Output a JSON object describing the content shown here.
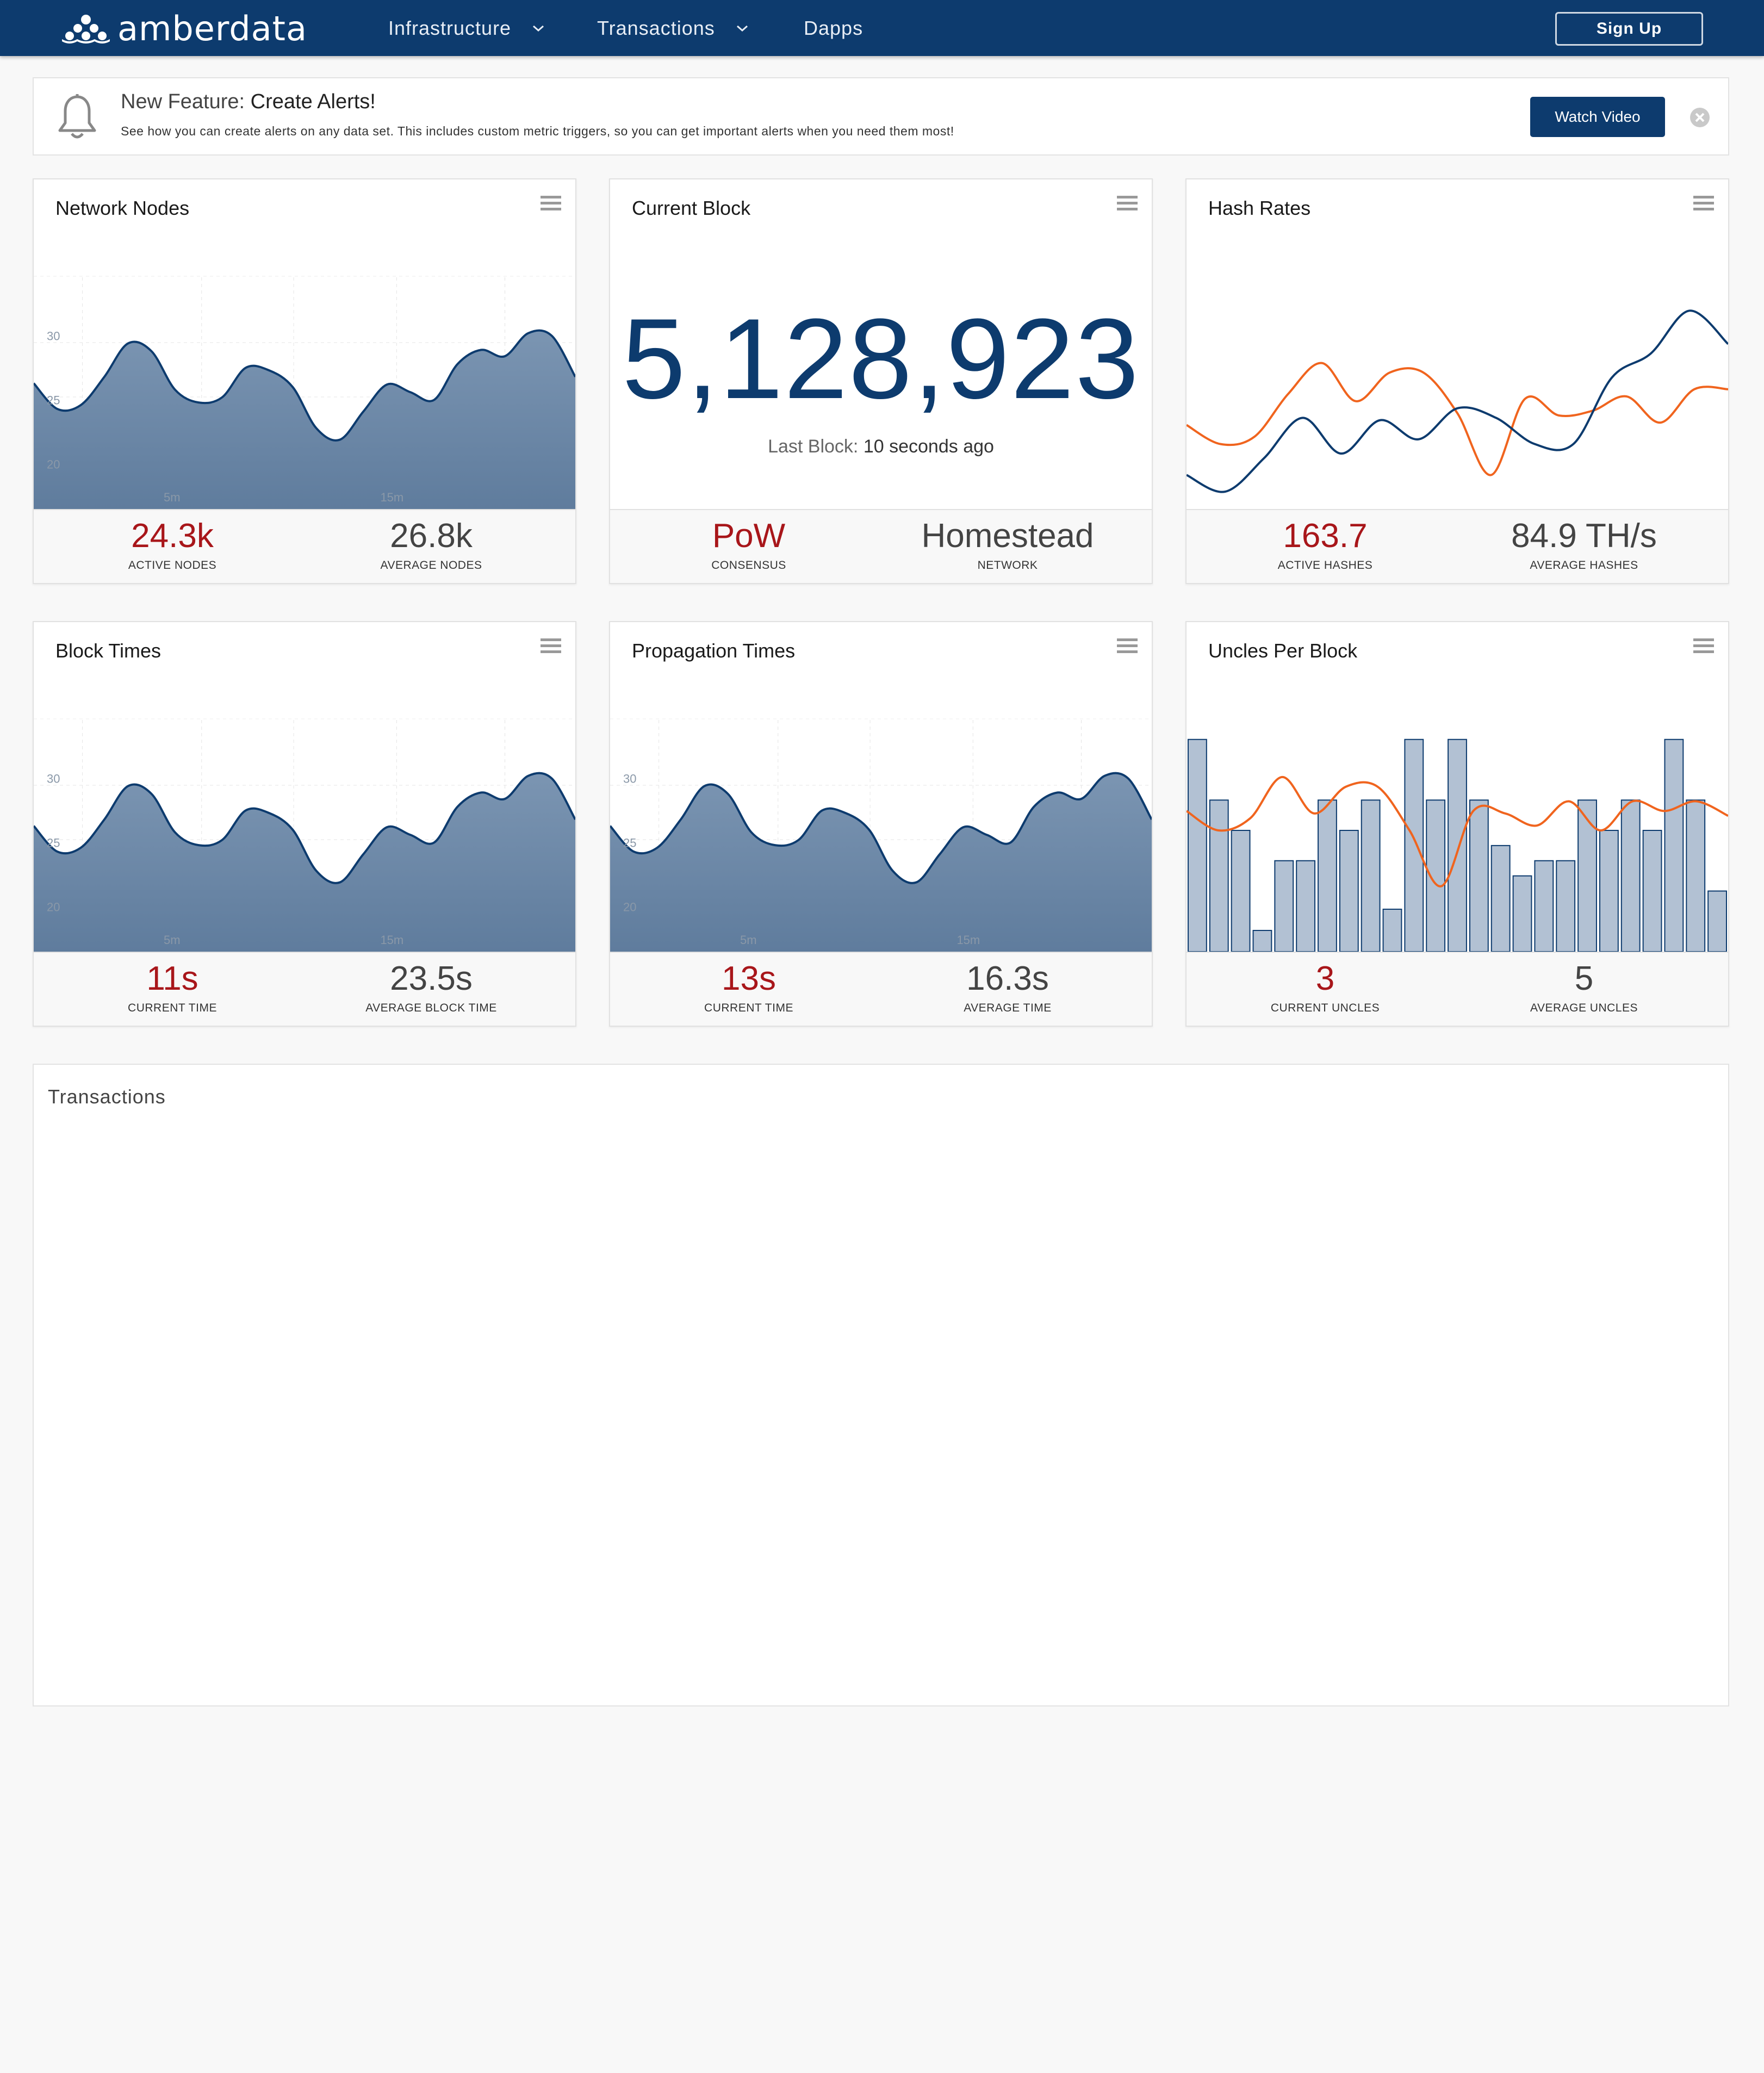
{
  "navbar": {
    "brand": "amberdata",
    "items": [
      {
        "label": "Infrastructure",
        "has_dropdown": true
      },
      {
        "label": "Transactions",
        "has_dropdown": true
      },
      {
        "label": "Dapps",
        "has_dropdown": false
      }
    ],
    "signup_label": "Sign Up"
  },
  "alert": {
    "prefix": "New Feature:",
    "title": "Create Alerts!",
    "text": "See how you can create alerts on any data set. This includes custom metric triggers, so you can get important alerts when you need them most!",
    "button_label": "Watch Video"
  },
  "cards": {
    "network_nodes": {
      "title": "Network Nodes",
      "stat1": {
        "value": "24.3k",
        "label": "ACTIVE NODES"
      },
      "stat2": {
        "value": "26.8k",
        "label": "AVERAGE NODES"
      }
    },
    "current_block": {
      "title": "Current Block",
      "number": "5,128,923",
      "last_block_label": "Last Block:",
      "last_block_value": "10 seconds ago",
      "stat1": {
        "value": "PoW",
        "label": "CONSENSUS"
      },
      "stat2": {
        "value": "Homestead",
        "label": "NETWORK"
      }
    },
    "hash_rates": {
      "title": "Hash Rates",
      "stat1": {
        "value": "163.7",
        "label": "ACTIVE HASHES"
      },
      "stat2": {
        "value": "84.9 TH/s",
        "label": "AVERAGE HASHES"
      }
    },
    "block_times": {
      "title": "Block Times",
      "stat1": {
        "value": "11s",
        "label": "CURRENT TIME"
      },
      "stat2": {
        "value": "23.5s",
        "label": "AVERAGE BLOCK TIME"
      }
    },
    "propagation_times": {
      "title": "Propagation Times",
      "stat1": {
        "value": "13s",
        "label": "CURRENT TIME"
      },
      "stat2": {
        "value": "16.3s",
        "label": "AVERAGE TIME"
      }
    },
    "uncles_per_block": {
      "title": "Uncles Per Block",
      "stat1": {
        "value": "3",
        "label": "CURRENT UNCLES"
      },
      "stat2": {
        "value": "5",
        "label": "AVERAGE UNCLES"
      }
    }
  },
  "transactions": {
    "title": "Transactions"
  },
  "colors": {
    "navy": "#0d3b6e",
    "red": "#a8161a",
    "orange": "#f0641e",
    "area_fill": "#6d8aa8",
    "bar_fill": "#b2c1d3"
  },
  "chart_data": [
    {
      "id": "network_nodes",
      "type": "area",
      "y_ticks": [
        30,
        25,
        20
      ],
      "x_ticks": [
        "5m",
        "15m"
      ],
      "values": [
        26.3,
        24.3,
        24.6,
        26.8,
        29.4,
        28.8,
        25.8,
        24.8,
        25.2,
        27.5,
        27.3,
        26.0,
        22.8,
        21.9,
        24.1,
        26.2,
        25.6,
        25.0,
        27.8,
        28.9,
        28.4,
        30.2,
        30.0,
        26.8
      ],
      "ylim": [
        16.5,
        35.4
      ]
    },
    {
      "id": "hash_rates",
      "type": "line",
      "series": [
        {
          "values": [
            28,
            20,
            23,
            41,
            54,
            38,
            50,
            50,
            33,
            7,
            39,
            32,
            34,
            40,
            29,
            43,
            43
          ]
        },
        {
          "values": [
            7,
            0,
            14,
            31,
            16,
            30,
            22,
            35,
            31,
            20,
            20,
            48,
            58,
            76,
            62
          ]
        }
      ],
      "ylim": [
        -5,
        90
      ]
    },
    {
      "id": "block_times",
      "type": "area",
      "y_ticks": [
        30,
        25,
        20
      ],
      "x_ticks": [
        "5m",
        "15m"
      ],
      "values": [
        26.3,
        24.3,
        24.6,
        26.8,
        29.4,
        28.8,
        25.8,
        24.8,
        25.2,
        27.5,
        27.3,
        26.0,
        22.8,
        21.9,
        24.1,
        26.2,
        25.6,
        25.0,
        27.8,
        28.9,
        28.4,
        30.2,
        30.0,
        26.8
      ],
      "ylim": [
        16.5,
        35.4
      ]
    },
    {
      "id": "propagation_times",
      "type": "area",
      "y_ticks": [
        30,
        25,
        20
      ],
      "x_ticks": [
        "5m",
        "15m"
      ],
      "values": [
        26.3,
        24.3,
        24.6,
        26.8,
        29.4,
        28.8,
        25.8,
        24.8,
        25.2,
        27.5,
        27.3,
        26.0,
        22.8,
        21.9,
        24.1,
        26.2,
        25.6,
        25.0,
        27.8,
        28.9,
        28.4,
        30.2,
        30.0,
        26.8
      ],
      "ylim": [
        16.5,
        35.4
      ]
    },
    {
      "id": "uncles_per_block",
      "type": "bar",
      "values": [
        7,
        5,
        4,
        0.7,
        3,
        3,
        5,
        4,
        5,
        1.4,
        7,
        5,
        7,
        5,
        3.5,
        2.5,
        3,
        3,
        5,
        4,
        5,
        4,
        7,
        5,
        2
      ],
      "ylim": [
        0,
        8
      ],
      "line": {
        "values": [
          58,
          50,
          55,
          72,
          57,
          68,
          68,
          50,
          27,
          58,
          57,
          52,
          62,
          50,
          62,
          58,
          62,
          56
        ]
      }
    }
  ]
}
